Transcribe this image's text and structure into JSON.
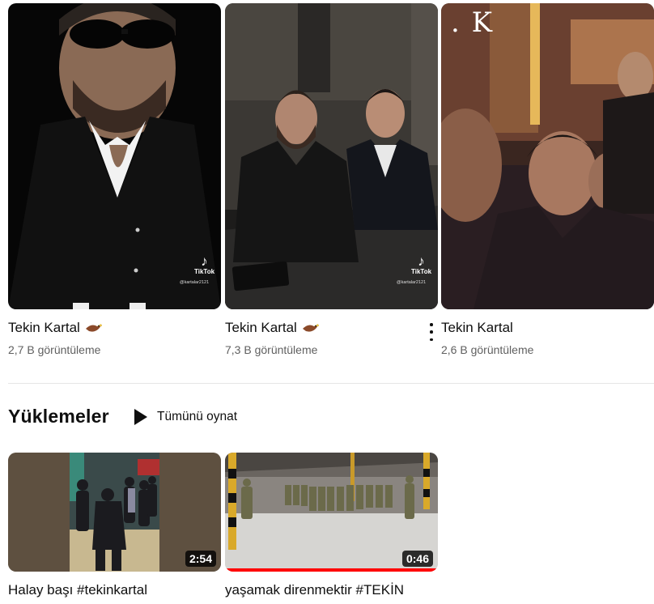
{
  "shorts": [
    {
      "title": "Tekin Kartal",
      "views": "2,7 B görüntüleme",
      "badge_icon": "eagle-emoji",
      "tiktok_label": "TikTok",
      "tiktok_user": "@kartalar2121"
    },
    {
      "title": "Tekin Kartal",
      "views": "7,3 B görüntüleme",
      "badge_icon": "eagle-emoji",
      "tiktok_label": "TikTok",
      "tiktok_user": "@kartalar2121"
    },
    {
      "title": "Tekin Kartal",
      "views": "2,6 B görüntüleme",
      "overlay_text": ". K"
    }
  ],
  "uploads": {
    "section_title": "Yüklemeler",
    "play_all_label": "Tümünü oynat",
    "videos": [
      {
        "title": "Halay başı #tekinkartal",
        "duration": "2:54",
        "progress": 0
      },
      {
        "title": "yaşamak direnmektir #TEKİN",
        "duration": "0:46",
        "progress": 1.0
      }
    ]
  },
  "colors": {
    "progress": "#ff0000",
    "secondary_text": "#606060",
    "divider": "#e5e5e5"
  }
}
